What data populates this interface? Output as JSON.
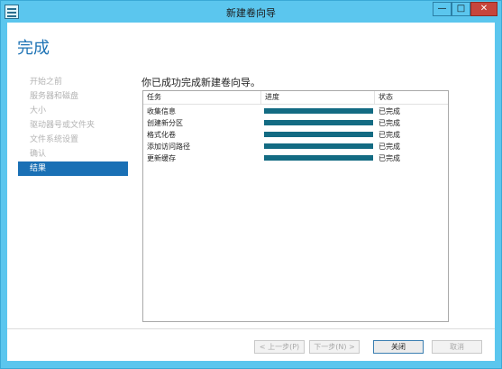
{
  "window": {
    "title": "新建卷向导",
    "controls": {
      "minimize": "—",
      "maximize": "□",
      "close": "✕"
    }
  },
  "page": {
    "heading": "完成",
    "message": "你已成功完成新建卷向导。"
  },
  "steps": [
    {
      "label": "开始之前",
      "active": false
    },
    {
      "label": "服务器和磁盘",
      "active": false
    },
    {
      "label": "大小",
      "active": false
    },
    {
      "label": "驱动器号或文件夹",
      "active": false
    },
    {
      "label": "文件系统设置",
      "active": false
    },
    {
      "label": "确认",
      "active": false
    },
    {
      "label": "结果",
      "active": true
    }
  ],
  "table": {
    "headers": {
      "task": "任务",
      "progress": "进度",
      "status": "状态"
    },
    "rows": [
      {
        "task": "收集信息",
        "progress": 1.0,
        "status": "已完成"
      },
      {
        "task": "创建新分区",
        "progress": 1.0,
        "status": "已完成"
      },
      {
        "task": "格式化卷",
        "progress": 1.0,
        "status": "已完成"
      },
      {
        "task": "添加访问路径",
        "progress": 1.0,
        "status": "已完成"
      },
      {
        "task": "更新缓存",
        "progress": 1.0,
        "status": "已完成"
      }
    ]
  },
  "buttons": {
    "prev": "< 上一步(P)",
    "next": "下一步(N) >",
    "close": "关闭",
    "cancel": "取消"
  },
  "colors": {
    "titlebar": "#5bc6ee",
    "accent": "#1a70b5",
    "progress": "#136b83",
    "close_button": "#c7453c"
  }
}
